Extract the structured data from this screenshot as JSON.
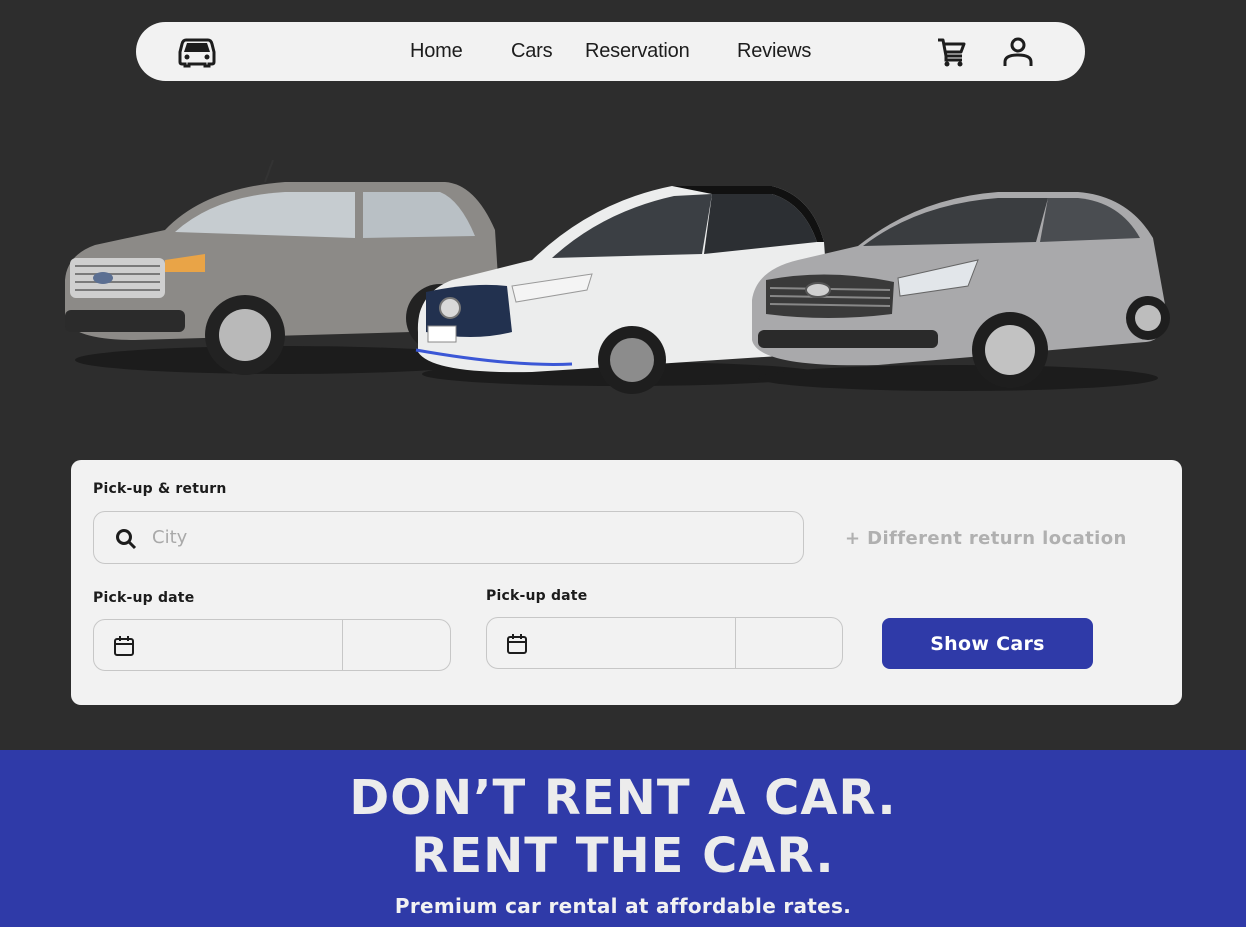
{
  "nav": {
    "logo_icon": "car-front-icon",
    "links": [
      "Home",
      "Cars",
      "Reservation",
      "Reviews"
    ],
    "cart_icon": "cart-icon",
    "account_icon": "user-icon"
  },
  "hero": {
    "cars": [
      "grey-suv",
      "white-hatchback",
      "silver-sedan"
    ]
  },
  "search": {
    "pickup_return_label": "Pick-up & return",
    "city_placeholder": "City",
    "different_return": "+ Different return location",
    "pickup_date_label": "Pick-up date",
    "return_date_label": "Pick-up date",
    "show_button": "Show Cars"
  },
  "banner": {
    "line1": "DON’T RENT A CAR.",
    "line2": "RENT THE CAR.",
    "subtitle": "Premium car rental at affordable rates."
  },
  "colors": {
    "background": "#2d2d2d",
    "panel": "#f2f2f2",
    "accent": "#2f3aa8"
  }
}
